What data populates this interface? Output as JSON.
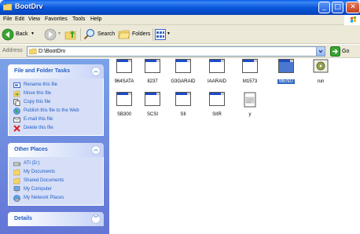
{
  "window": {
    "title": "BootDrv"
  },
  "menu": {
    "items": [
      "File",
      "Edit",
      "View",
      "Favorites",
      "Tools",
      "Help"
    ]
  },
  "toolbar": {
    "back_label": "Back",
    "search_label": "Search",
    "folders_label": "Folders"
  },
  "address": {
    "label": "Address",
    "value": "D:\\BootDrv",
    "go_label": "Go"
  },
  "sidebar": {
    "file_tasks": {
      "title": "File and Folder Tasks",
      "items": [
        {
          "label": "Rename this file",
          "icon": "rename-icon"
        },
        {
          "label": "Move this file",
          "icon": "move-icon"
        },
        {
          "label": "Copy this file",
          "icon": "copy-icon"
        },
        {
          "label": "Publish this file to the Web",
          "icon": "publish-icon"
        },
        {
          "label": "E-mail this file",
          "icon": "email-icon"
        },
        {
          "label": "Delete this file",
          "icon": "delete-icon"
        }
      ]
    },
    "other_places": {
      "title": "Other Places",
      "items": [
        {
          "label": "ATI (D:)",
          "icon": "drive-icon"
        },
        {
          "label": "My Documents",
          "icon": "folder-icon"
        },
        {
          "label": "Shared Documents",
          "icon": "folder-icon"
        },
        {
          "label": "My Computer",
          "icon": "computer-icon"
        },
        {
          "label": "My Network Places",
          "icon": "network-icon"
        }
      ]
    },
    "details": {
      "title": "Details"
    }
  },
  "files": [
    {
      "name": "964SATA",
      "type": "app"
    },
    {
      "name": "8237",
      "type": "app"
    },
    {
      "name": "G3GARAID",
      "type": "app"
    },
    {
      "name": "IAARAID",
      "type": "app"
    },
    {
      "name": "M1573",
      "type": "app"
    },
    {
      "name": "MENU",
      "type": "app",
      "selected": true
    },
    {
      "name": "run",
      "type": "batch"
    },
    {
      "name": "SB300",
      "type": "app"
    },
    {
      "name": "SCSI",
      "type": "app"
    },
    {
      "name": "SII",
      "type": "app"
    },
    {
      "name": "SIIR",
      "type": "app"
    },
    {
      "name": "y",
      "type": "text"
    }
  ],
  "colors": {
    "title_blue": "#0a58db",
    "task_link": "#215dc6",
    "selection": "#316ac5"
  }
}
